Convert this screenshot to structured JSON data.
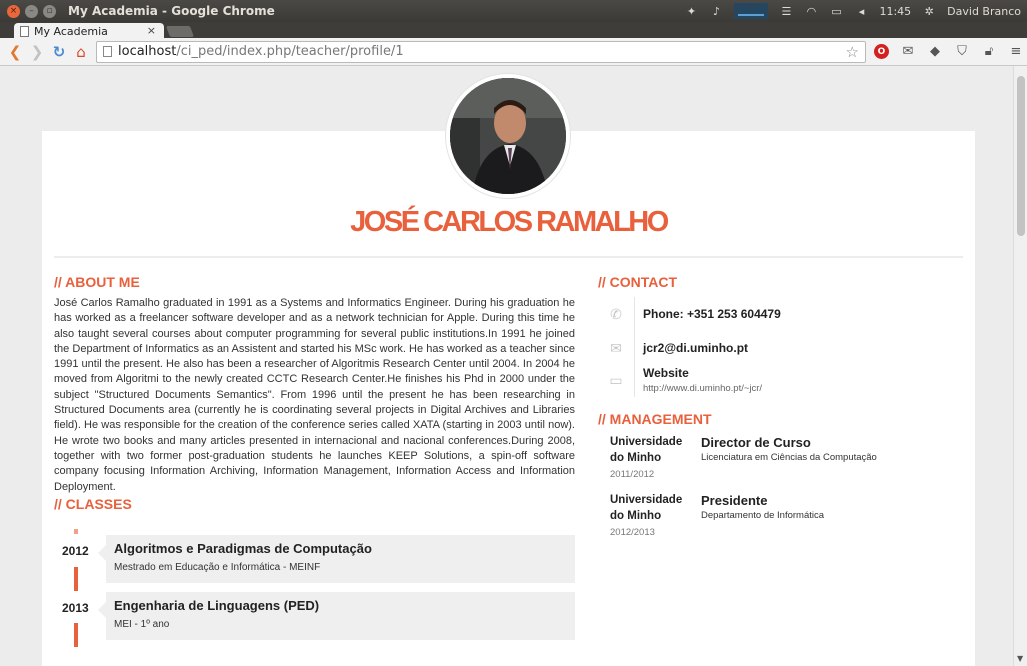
{
  "os": {
    "window_title": "My Academia - Google Chrome",
    "clock": "11:45",
    "user": "David Branco"
  },
  "browser": {
    "tab_title": "My Academia",
    "tab_close": "×",
    "url_host": "localhost",
    "url_path": "/ci_ped/index.php/teacher/profile/1"
  },
  "profile": {
    "name": "JOSÉ CARLOS RAMALHO"
  },
  "about": {
    "heading": "// ABOUT ME",
    "text": "José Carlos Ramalho graduated in 1991 as a Systems and Informatics Engineer. During his graduation he has worked as a freelancer software developer and as a network technician for Apple. During this time he also taught several courses about computer programming for several public institutions.In 1991 he joined the Department of Informatics as an Assistent and started his MSc work. He has worked as a teacher since 1991 until the present. He also has been a researcher of Algoritmis Research Center until 2004. In 2004 he moved from Algoritmi to the newly created CCTC Research Center.He finishes his Phd in 2000 under the subject \"Structured Documents Semantics\". From 1996 until the present he has been researching in Structured Documents area (currently he is coordinating several projects in Digital Archives and Libraries field). He was responsible for the creation of the conference series called XATA (starting in 2003 until now). He wrote two books and many articles presented in internacional and nacional conferences.During 2008, together with two former post-graduation students he launches KEEP Solutions, a spin-off software company focusing Information Archiving, Information Management, Information Access and Information Deployment."
  },
  "classes": {
    "heading": "// CLASSES",
    "items": [
      {
        "year": "2012",
        "title": "Algoritmos e Paradigmas de Computação",
        "course": "Mestrado em Educação e Informática - MEINF"
      },
      {
        "year": "2013",
        "title": "Engenharia de Linguagens (PED)",
        "course": "MEI - 1º ano"
      }
    ]
  },
  "contact": {
    "heading": "// CONTACT",
    "phone": "Phone: +351 253 604479",
    "email": "jcr2@di.uminho.pt",
    "website_label": "Website",
    "website_url": "http://www.di.uminho.pt/~jcr/"
  },
  "management": {
    "heading": "// MANAGEMENT",
    "items": [
      {
        "org": "Universidade do Minho",
        "year": "2011/2012",
        "role": "Director de Curso",
        "desc": "Licenciatura em Ciências da Computação"
      },
      {
        "org": "Universidade do Minho",
        "year": "2012/2013",
        "role": "Presidente",
        "desc": "Departamento de Informática"
      }
    ]
  },
  "colors": {
    "accent": "#e8603c",
    "os_bar": "#3b3a36"
  }
}
